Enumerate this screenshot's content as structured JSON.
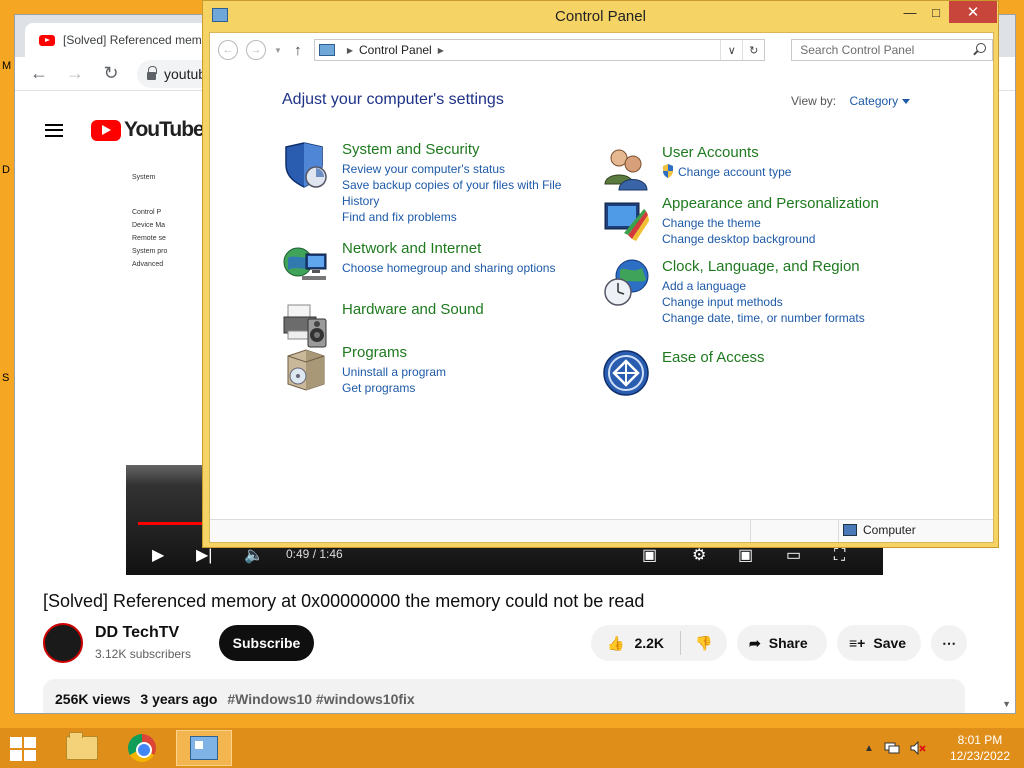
{
  "desktop": {
    "edge_letters": [
      "M",
      "D",
      "S"
    ]
  },
  "browser": {
    "tab_title": "[Solved] Referenced memo",
    "url": "youtub",
    "youtube_logo": "YouTube"
  },
  "video": {
    "time": "0:49 / 1:46",
    "mini_items": [
      "System",
      "Control P",
      "Device Ma",
      "Remote se",
      "System pro",
      "Advanced"
    ],
    "progress": 0.46
  },
  "watch": {
    "title": "[Solved] Referenced memory at 0x00000000 the memory could not be read",
    "channel_name": "DD TechTV",
    "channel_subs": "3.12K subscribers",
    "subscribe": "Subscribe",
    "likes": "2.2K",
    "share": "Share",
    "save": "Save",
    "views": "256K views",
    "age": "3 years ago",
    "tags": "#Windows10 #windows10fix"
  },
  "control_panel": {
    "title": "Control Panel",
    "breadcrumb": "Control Panel",
    "search_placeholder": "Search Control Panel",
    "heading": "Adjust your computer's settings",
    "view_by_label": "View by:",
    "view_by_value": "Category",
    "status": "Computer",
    "categories": [
      {
        "title": "System and Security",
        "links": [
          "Review your computer's status",
          "Save backup copies of your files with File",
          "History",
          "Find and fix problems"
        ]
      },
      {
        "title": "Network and Internet",
        "links": [
          "Choose homegroup and sharing options"
        ]
      },
      {
        "title": "Hardware and Sound",
        "links": []
      },
      {
        "title": "Programs",
        "links": [
          "Uninstall a program",
          "Get programs"
        ]
      },
      {
        "title": "User Accounts",
        "links": [
          "Change account type"
        ]
      },
      {
        "title": "Appearance and Personalization",
        "links": [
          "Change the theme",
          "Change desktop background"
        ]
      },
      {
        "title": "Clock, Language, and Region",
        "links": [
          "Add a language",
          "Change input methods",
          "Change date, time, or number formats"
        ]
      },
      {
        "title": "Ease of Access",
        "links": []
      }
    ]
  },
  "taskbar": {
    "time": "8:01 PM",
    "date": "12/23/2022"
  },
  "colors": {
    "desktop": "#f5a623",
    "taskbar": "#e08e1a",
    "window_frame": "#f6d365",
    "category_title": "#1f7a1f",
    "link": "#1e5aa8",
    "close": "#c7453a",
    "youtube_red": "#ff0000"
  }
}
